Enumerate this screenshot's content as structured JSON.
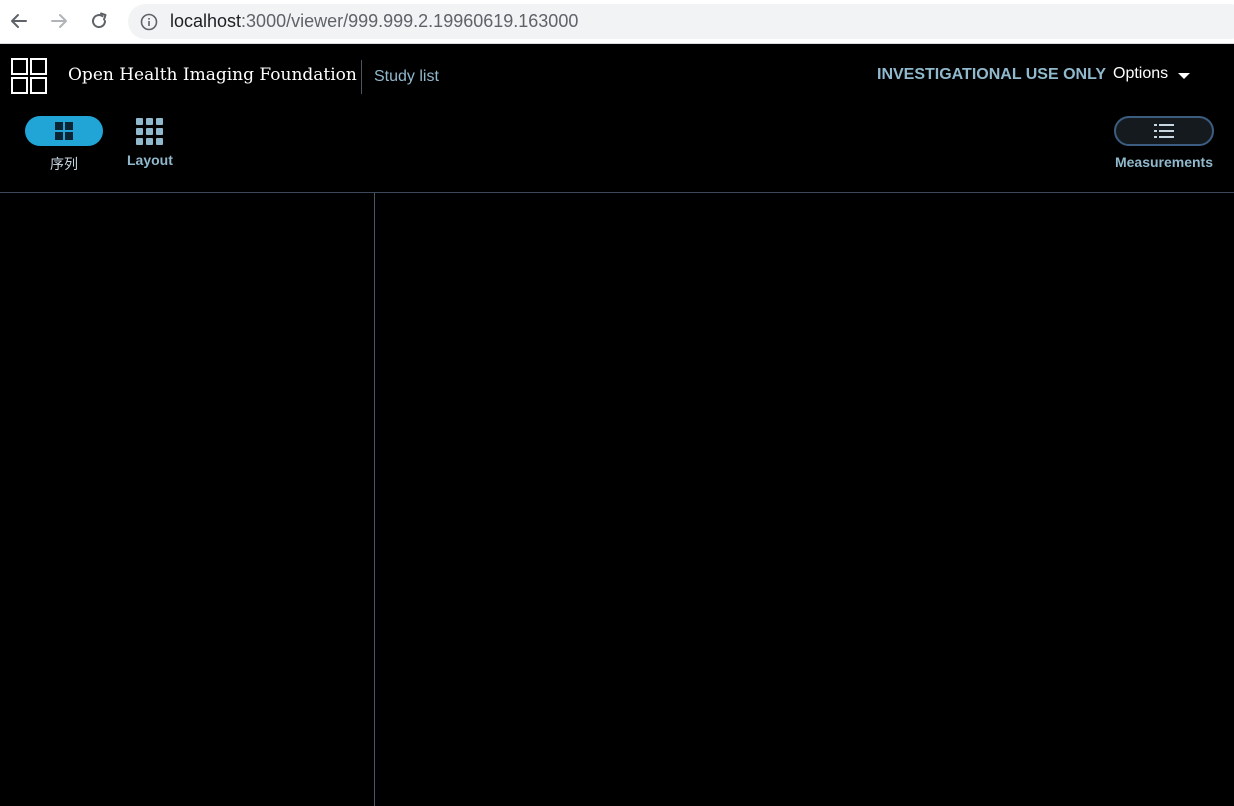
{
  "browser": {
    "url_host": "localhost",
    "url_path": ":3000/viewer/999.999.2.19960619.163000"
  },
  "header": {
    "brand": "Open Health Imaging Foundation",
    "study_list_label": "Study list",
    "investigational_label": "INVESTIGATIONAL USE ONLY",
    "options_label": "Options"
  },
  "toolbar": {
    "series_label": "序列",
    "layout_label": "Layout",
    "measurements_label": "Measurements"
  },
  "colors": {
    "accent": "#20a5d6",
    "link": "#91b9cd",
    "background": "#000000"
  }
}
